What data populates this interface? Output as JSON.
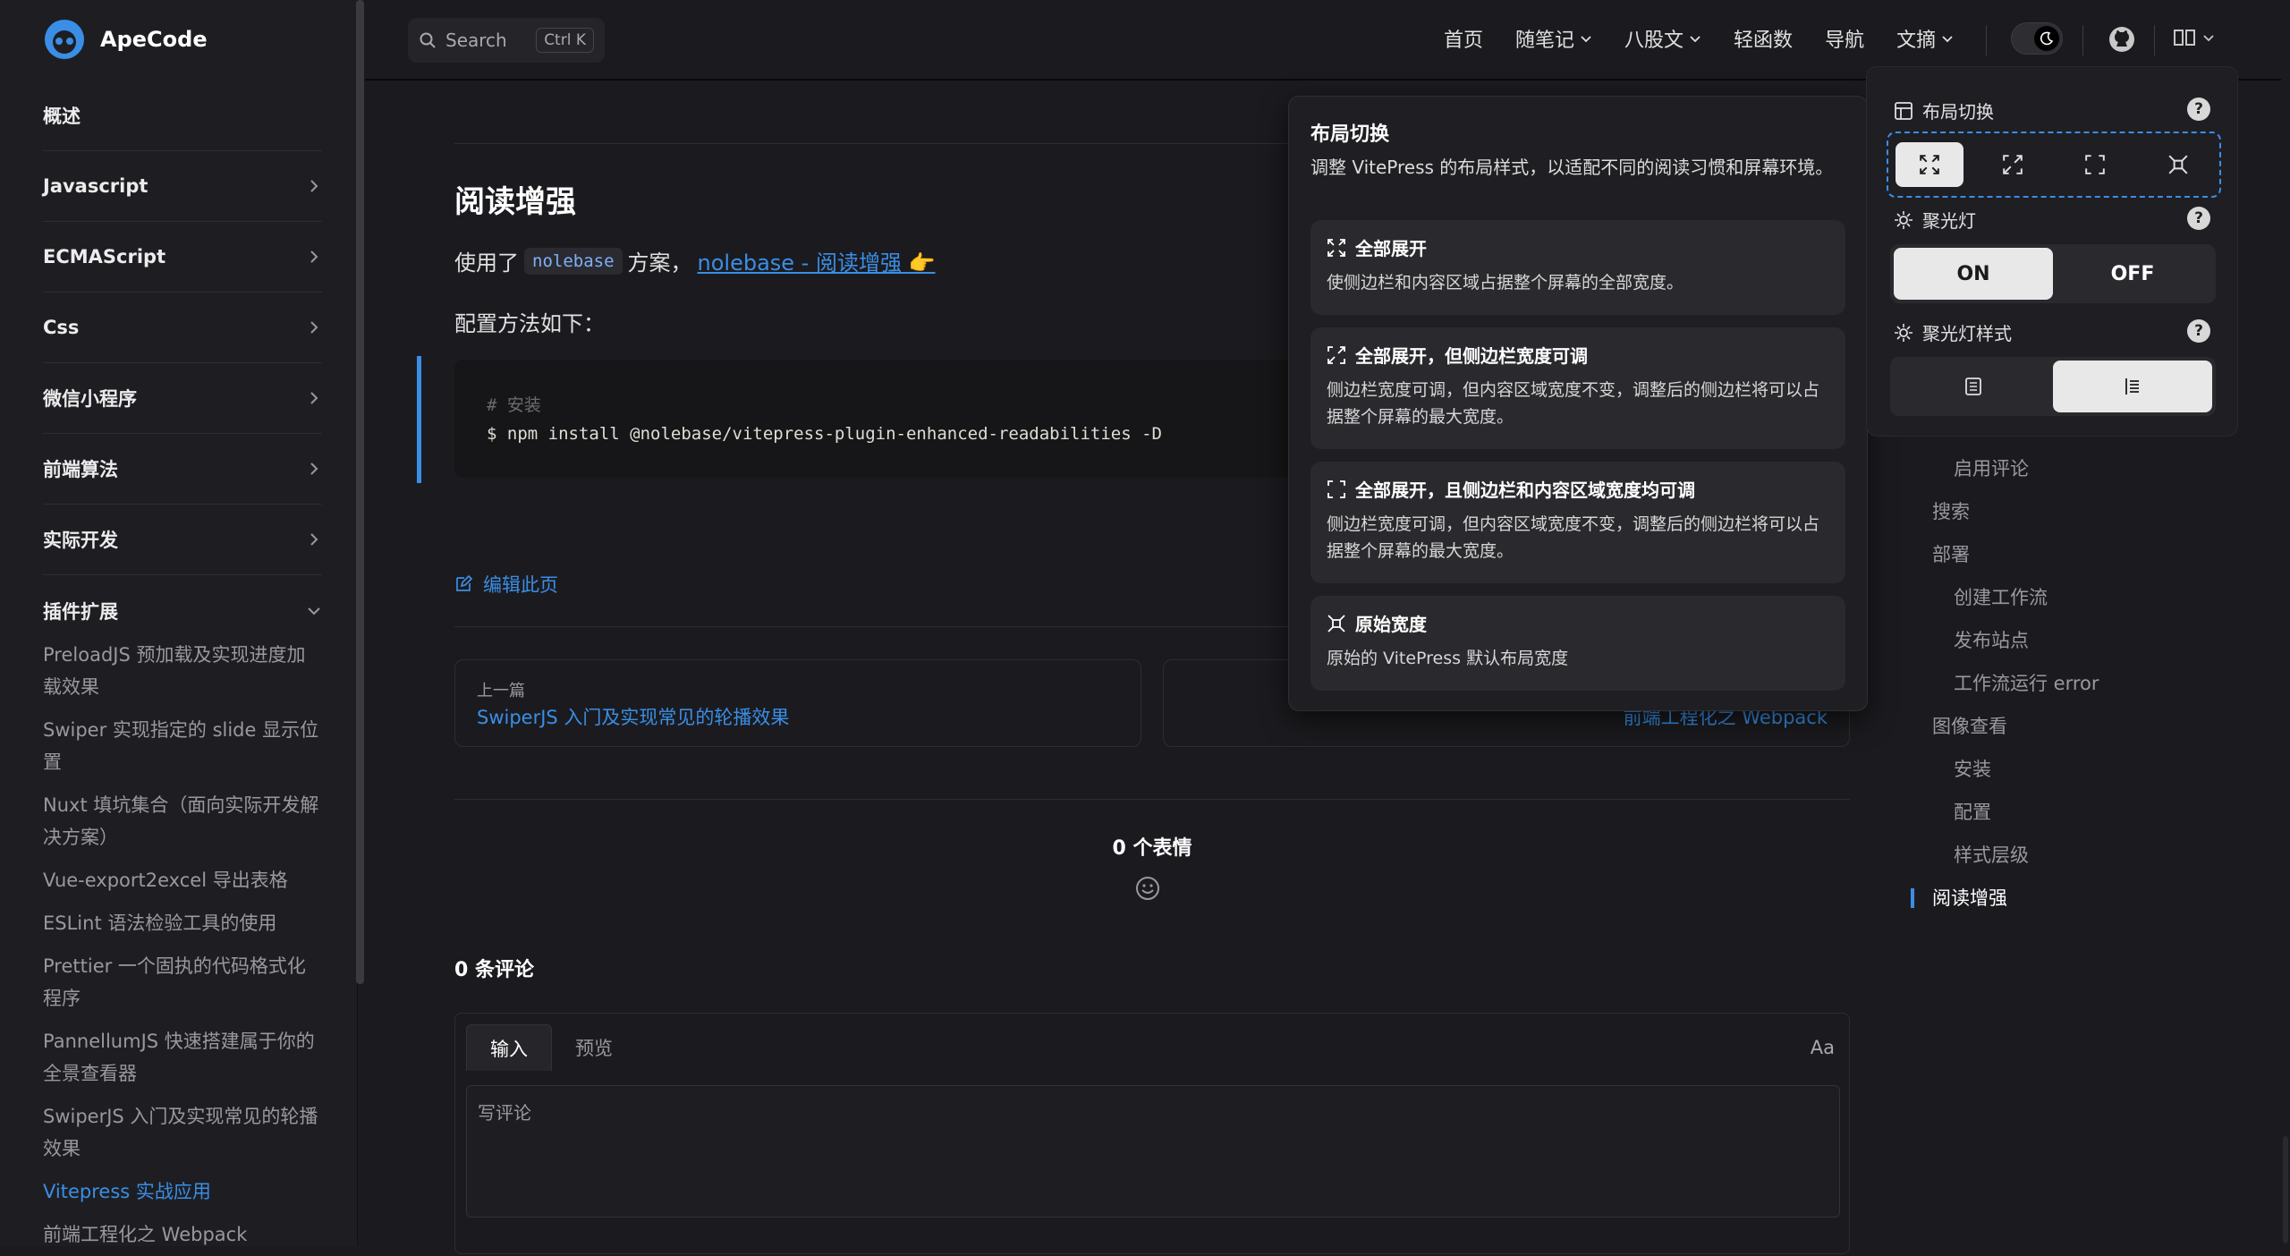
{
  "brand": {
    "name": "ApeCode"
  },
  "search": {
    "label": "Search",
    "shortcut": "Ctrl K"
  },
  "nav": {
    "items": [
      "首页",
      "随笔记",
      "八股文",
      "轻函数",
      "导航",
      "文摘"
    ]
  },
  "sidebar": {
    "sections": [
      "概述",
      "Javascript",
      "ECMAScript",
      "Css",
      "微信小程序",
      "前端算法",
      "实际开发",
      "插件扩展"
    ],
    "sub_items": [
      "PreloadJS 预加载及实现进度加载效果",
      "Swiper 实现指定的 slide 显示位置",
      "Nuxt 填坑集合（面向实际开发解决方案）",
      "Vue-export2excel 导出表格",
      "ESLint 语法检验工具的使用",
      "Prettier 一个固执的代码格式化程序",
      "PannellumJS 快速搭建属于你的全景查看器",
      "SwiperJS 入门及实现常见的轮播效果",
      "Vitepress 实战应用",
      "前端工程化之 Webpack"
    ],
    "active_sub": "Vitepress 实战应用"
  },
  "content": {
    "heading": "阅读增强",
    "intro_prefix": "使用了",
    "intro_code": "nolebase",
    "intro_middle": "方案，",
    "intro_link": "nolebase - 阅读增强 👉",
    "config_text": "配置方法如下：",
    "code_comment": "# 安装",
    "code_command": "$ npm install @nolebase/vitepress-plugin-enhanced-readabilities -D",
    "edit_link": "编辑此页",
    "prev_label": "上一篇",
    "prev_title": "SwiperJS 入门及实现常见的轮播效果",
    "next_title": "前端工程化之 Webpack",
    "reactions": "0 个表情",
    "comments_title": "0 条评论",
    "tab_input": "输入",
    "tab_preview": "预览",
    "font_toggle": "Aa",
    "comment_placeholder": "写评论"
  },
  "outline": {
    "items": [
      {
        "label": "启用评论",
        "sub": true
      },
      {
        "label": "搜索",
        "sub": false
      },
      {
        "label": "部署",
        "sub": false
      },
      {
        "label": "创建工作流",
        "sub": true
      },
      {
        "label": "发布站点",
        "sub": true
      },
      {
        "label": "工作流运行 error",
        "sub": true
      },
      {
        "label": "图像查看",
        "sub": false
      },
      {
        "label": "安装",
        "sub": true
      },
      {
        "label": "配置",
        "sub": true
      },
      {
        "label": "样式层级",
        "sub": true
      },
      {
        "label": "阅读增强",
        "sub": false,
        "active": true
      }
    ]
  },
  "popover": {
    "title": "布局切换",
    "desc": "调整 VitePress 的布局样式，以适配不同的阅读习惯和屏幕环境。",
    "cards": [
      {
        "title": "全部展开",
        "body": "使侧边栏和内容区域占据整个屏幕的全部宽度。"
      },
      {
        "title": "全部展开，但侧边栏宽度可调",
        "body": "侧边栏宽度可调，但内容区域宽度不变，调整后的侧边栏将可以占据整个屏幕的最大宽度。"
      },
      {
        "title": "全部展开，且侧边栏和内容区域宽度均可调",
        "body": "侧边栏宽度可调，但内容区域宽度不变，调整后的侧边栏将可以占据整个屏幕的最大宽度。"
      },
      {
        "title": "原始宽度",
        "body": "原始的 VitePress 默认布局宽度"
      }
    ]
  },
  "panel": {
    "layout_label": "布局切换",
    "spotlight_label": "聚光灯",
    "spotlight_on": "ON",
    "spotlight_off": "OFF",
    "spotlight_style_label": "聚光灯样式",
    "help": "?"
  },
  "colors": {
    "accent": "#3a8ee6",
    "bg": "#1b1b1f"
  }
}
